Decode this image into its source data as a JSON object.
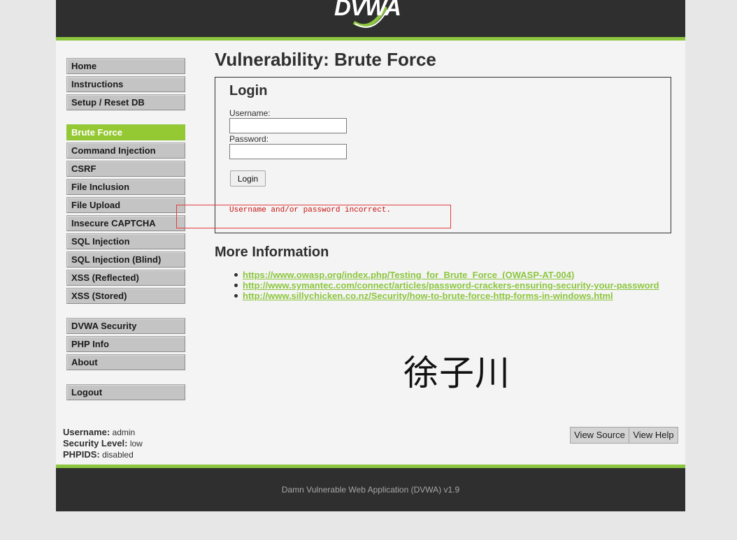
{
  "header": {
    "logo_text": "DVWA"
  },
  "menu": {
    "items": [
      {
        "label": "Home"
      },
      {
        "label": "Instructions"
      },
      {
        "label": "Setup / Reset DB"
      },
      {
        "label": "Brute Force",
        "selected": true
      },
      {
        "label": "Command Injection"
      },
      {
        "label": "CSRF"
      },
      {
        "label": "File Inclusion"
      },
      {
        "label": "File Upload"
      },
      {
        "label": "Insecure CAPTCHA"
      },
      {
        "label": "SQL Injection"
      },
      {
        "label": "SQL Injection (Blind)"
      },
      {
        "label": "XSS (Reflected)"
      },
      {
        "label": "XSS (Stored)"
      },
      {
        "label": "DVWA Security"
      },
      {
        "label": "PHP Info"
      },
      {
        "label": "About"
      },
      {
        "label": "Logout"
      }
    ]
  },
  "main": {
    "page_title": "Vulnerability: Brute Force",
    "login": {
      "title": "Login",
      "username_label": "Username:",
      "username_value": "",
      "password_label": "Password:",
      "password_value": "",
      "button_label": "Login",
      "error_message": "Username and/or password incorrect."
    },
    "more_info": {
      "title": "More Information",
      "links": [
        "https://www.owasp.org/index.php/Testing_for_Brute_Force_(OWASP-AT-004)",
        "http://www.symantec.com/connect/articles/password-crackers-ensuring-security-your-password",
        "http://www.sillychicken.co.nz/Security/how-to-brute-force-http-forms-in-windows.html"
      ]
    },
    "watermark": "徐子川"
  },
  "footer_buttons": {
    "view_source": "View Source",
    "view_help": "View Help"
  },
  "system_info": {
    "username_key": "Username:",
    "username_value": "admin",
    "security_key": "Security Level:",
    "security_value": "low",
    "phpids_key": "PHPIDS:",
    "phpids_value": "disabled"
  },
  "footer": {
    "text": "Damn Vulnerable Web Application (DVWA) v1.9"
  },
  "colors": {
    "accent": "#8cc63e",
    "header_bg": "#2f2f2f",
    "error": "#c81010"
  }
}
